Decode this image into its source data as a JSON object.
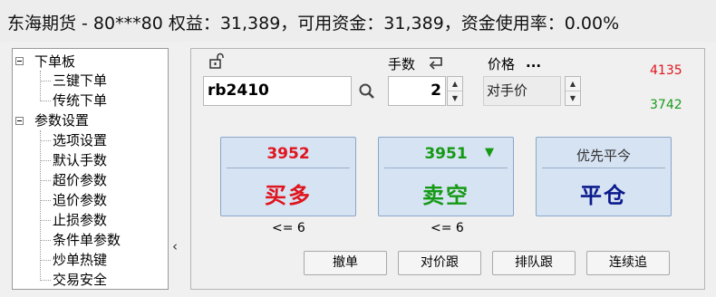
{
  "header": {
    "text": "东海期货 - 80***80  权益：31,389，可用资金：31,389，资金使用率：0.00%"
  },
  "tree": {
    "groups": [
      {
        "label": "下单板",
        "items": [
          "三键下单",
          "传统下单"
        ]
      },
      {
        "label": "参数设置",
        "items": [
          "选项设置",
          "默认手数",
          "超价参数",
          "追价参数",
          "止损参数",
          "条件单参数",
          "炒单热键",
          "交易安全"
        ]
      }
    ]
  },
  "collapse_glyph": "‹",
  "order": {
    "symbol": "rb2410",
    "quantity_label": "手数",
    "quantity": "2",
    "price_label": "价格",
    "price_more": "...",
    "price_mode": "对手价",
    "ask_price": "4135",
    "bid_price": "3742"
  },
  "buttons": {
    "buy": {
      "price": "3952",
      "label": "买多",
      "limit": "<= 6"
    },
    "sell": {
      "price": "3951",
      "label": "卖空",
      "limit": "<= 6",
      "arrow": "▼"
    },
    "close": {
      "price": "优先平今",
      "label": "平仓"
    }
  },
  "actions": [
    "撤单",
    "对价跟",
    "排队跟",
    "连续追"
  ],
  "colors": {
    "buy": "#e0141c",
    "sell": "#159a15",
    "close": "#0b1a8c",
    "ask": "#e0141c",
    "bid": "#1a9a1a"
  }
}
